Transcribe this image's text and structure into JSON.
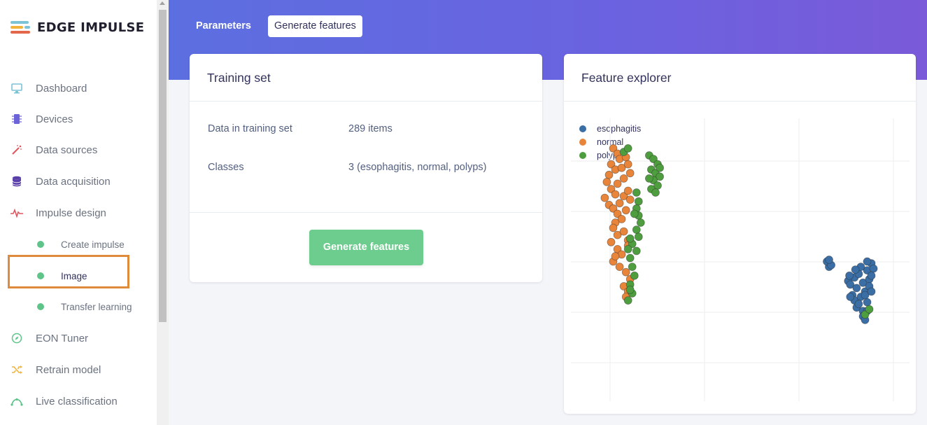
{
  "brand": {
    "name": "EDGE IMPULSE"
  },
  "sidebar": {
    "items": [
      {
        "label": "Dashboard",
        "icon": "monitor-icon"
      },
      {
        "label": "Devices",
        "icon": "chip-icon"
      },
      {
        "label": "Data sources",
        "icon": "magic-wand-icon"
      },
      {
        "label": "Data acquisition",
        "icon": "database-icon"
      },
      {
        "label": "Impulse design",
        "icon": "pulse-icon"
      },
      {
        "label": "EON Tuner",
        "icon": "compass-icon"
      },
      {
        "label": "Retrain model",
        "icon": "shuffle-icon"
      },
      {
        "label": "Live classification",
        "icon": "curve-icon"
      }
    ],
    "sub_items": [
      {
        "label": "Create impulse"
      },
      {
        "label": "Image"
      },
      {
        "label": "Transfer learning"
      }
    ]
  },
  "tabs": {
    "parameters": "Parameters",
    "generate_features": "Generate features"
  },
  "training_set": {
    "title": "Training set",
    "data_label": "Data in training set",
    "data_value": "289 items",
    "classes_label": "Classes",
    "classes_value": "3 (esophagitis, normal, polyps)",
    "button_label": "Generate features"
  },
  "feature_explorer": {
    "title": "Feature explorer"
  },
  "colors": {
    "esophagitis": "#3a6ea5",
    "normal": "#e8853a",
    "polyps": "#4e9e3f",
    "accent_green": "#6dcd8e",
    "highlight": "#e08a3c"
  },
  "chart_data": {
    "type": "scatter",
    "title": "",
    "xlabel": "",
    "ylabel": "",
    "xlim": [
      0,
      8
    ],
    "ylim": [
      0,
      8
    ],
    "grid": true,
    "legend_position": "top-left",
    "series": [
      {
        "name": "esophagitis",
        "points": [
          [
            6.1,
            3.8
          ],
          [
            6.05,
            3.95
          ],
          [
            6.15,
            3.85
          ],
          [
            6.1,
            4.0
          ],
          [
            6.55,
            3.4
          ],
          [
            6.6,
            3.3
          ],
          [
            6.7,
            3.5
          ],
          [
            6.75,
            3.2
          ],
          [
            6.8,
            3.6
          ],
          [
            6.65,
            3.0
          ],
          [
            6.7,
            2.85
          ],
          [
            6.85,
            2.95
          ],
          [
            6.9,
            3.35
          ],
          [
            6.95,
            3.1
          ],
          [
            7.0,
            3.7
          ],
          [
            7.05,
            3.45
          ],
          [
            6.6,
            2.95
          ],
          [
            6.75,
            2.65
          ],
          [
            6.8,
            2.75
          ],
          [
            6.9,
            2.55
          ],
          [
            7.0,
            2.8
          ],
          [
            6.95,
            3.0
          ],
          [
            7.05,
            3.25
          ],
          [
            7.1,
            3.9
          ],
          [
            7.15,
            3.75
          ],
          [
            7.1,
            3.55
          ],
          [
            6.85,
            3.8
          ],
          [
            7.0,
            3.95
          ],
          [
            6.58,
            3.55
          ],
          [
            6.72,
            3.72
          ],
          [
            6.9,
            2.4
          ],
          [
            6.95,
            2.3
          ],
          [
            7.0,
            2.55
          ],
          [
            7.1,
            3.1
          ]
        ]
      },
      {
        "name": "normal",
        "points": [
          [
            1.0,
            7.15
          ],
          [
            1.1,
            7.0
          ],
          [
            1.15,
            6.85
          ],
          [
            0.95,
            6.7
          ],
          [
            1.05,
            6.55
          ],
          [
            1.2,
            6.6
          ],
          [
            1.3,
            6.9
          ],
          [
            1.35,
            6.7
          ],
          [
            1.4,
            6.45
          ],
          [
            1.25,
            6.3
          ],
          [
            1.1,
            6.15
          ],
          [
            0.9,
            6.4
          ],
          [
            0.85,
            6.2
          ],
          [
            0.95,
            6.0
          ],
          [
            1.05,
            5.85
          ],
          [
            0.8,
            5.75
          ],
          [
            0.9,
            5.55
          ],
          [
            1.0,
            5.45
          ],
          [
            1.15,
            5.6
          ],
          [
            1.25,
            5.8
          ],
          [
            1.35,
            5.95
          ],
          [
            1.4,
            5.7
          ],
          [
            1.1,
            5.3
          ],
          [
            1.2,
            5.15
          ],
          [
            1.3,
            5.4
          ],
          [
            1.05,
            5.05
          ],
          [
            1.0,
            4.9
          ],
          [
            1.1,
            4.7
          ],
          [
            1.25,
            4.8
          ],
          [
            1.35,
            4.55
          ],
          [
            0.95,
            4.5
          ],
          [
            1.1,
            4.3
          ],
          [
            1.2,
            4.15
          ],
          [
            1.35,
            4.4
          ],
          [
            1.0,
            3.95
          ],
          [
            1.15,
            3.8
          ],
          [
            1.3,
            3.65
          ],
          [
            1.25,
            3.25
          ],
          [
            1.35,
            3.1
          ],
          [
            1.3,
            2.95
          ],
          [
            1.05,
            4.1
          ],
          [
            1.4,
            3.45
          ]
        ]
      },
      {
        "name": "polyps",
        "points": [
          [
            1.85,
            6.95
          ],
          [
            1.95,
            6.85
          ],
          [
            2.05,
            6.7
          ],
          [
            1.9,
            6.55
          ],
          [
            2.0,
            6.45
          ],
          [
            2.1,
            6.35
          ],
          [
            1.95,
            6.25
          ],
          [
            2.05,
            6.1
          ],
          [
            1.9,
            6.0
          ],
          [
            2.0,
            5.9
          ],
          [
            1.85,
            6.3
          ],
          [
            2.1,
            6.6
          ],
          [
            1.55,
            5.9
          ],
          [
            1.6,
            5.65
          ],
          [
            1.55,
            5.45
          ],
          [
            1.6,
            5.25
          ],
          [
            1.65,
            5.05
          ],
          [
            1.5,
            5.3
          ],
          [
            1.55,
            4.85
          ],
          [
            1.6,
            4.65
          ],
          [
            1.45,
            4.45
          ],
          [
            1.55,
            4.25
          ],
          [
            1.4,
            4.05
          ],
          [
            1.45,
            3.8
          ],
          [
            1.5,
            3.55
          ],
          [
            1.4,
            3.3
          ],
          [
            1.45,
            3.05
          ],
          [
            1.35,
            2.85
          ],
          [
            1.4,
            4.6
          ],
          [
            1.35,
            4.3
          ],
          [
            1.25,
            7.05
          ],
          [
            1.35,
            7.15
          ],
          [
            1.4,
            3.15
          ],
          [
            6.95,
            2.45
          ],
          [
            7.05,
            2.6
          ]
        ]
      }
    ]
  }
}
